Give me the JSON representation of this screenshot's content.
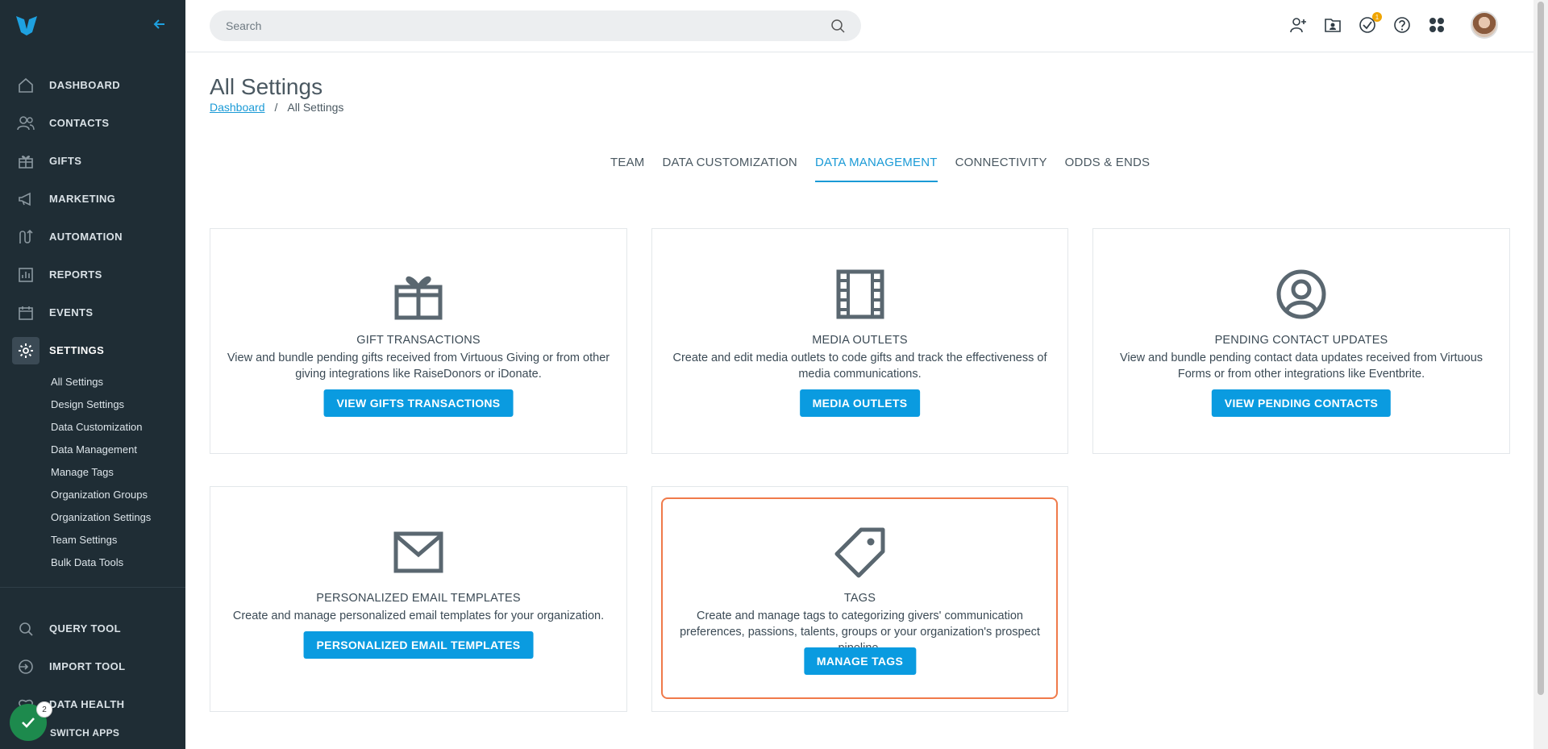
{
  "sidebar": {
    "nav": [
      {
        "label": "DASHBOARD",
        "icon": "home-icon"
      },
      {
        "label": "CONTACTS",
        "icon": "people-icon"
      },
      {
        "label": "GIFTS",
        "icon": "gift-icon"
      },
      {
        "label": "MARKETING",
        "icon": "megaphone-icon"
      },
      {
        "label": "AUTOMATION",
        "icon": "automation-icon"
      },
      {
        "label": "REPORTS",
        "icon": "reports-icon"
      },
      {
        "label": "EVENTS",
        "icon": "calendar-icon"
      },
      {
        "label": "SETTINGS",
        "icon": "gear-icon"
      }
    ],
    "subnav": [
      "All Settings",
      "Design Settings",
      "Data Customization",
      "Data Management",
      "Manage Tags",
      "Organization Groups",
      "Organization Settings",
      "Team Settings",
      "Bulk Data Tools"
    ],
    "bottom": [
      {
        "label": "QUERY TOOL",
        "icon": "query-icon"
      },
      {
        "label": "IMPORT TOOL",
        "icon": "import-icon"
      },
      {
        "label": "DATA HEALTH",
        "icon": "health-icon"
      }
    ],
    "task_count": "2",
    "switch_apps": "SWITCH APPS"
  },
  "topbar": {
    "search_placeholder": "Search",
    "notification_count": "1"
  },
  "page": {
    "title": "All Settings",
    "breadcrumb_link": "Dashboard",
    "breadcrumb_sep": "/",
    "breadcrumb_current": "All Settings"
  },
  "tabs": [
    "TEAM",
    "DATA CUSTOMIZATION",
    "DATA MANAGEMENT",
    "CONNECTIVITY",
    "ODDS & ENDS"
  ],
  "active_tab": "DATA MANAGEMENT",
  "cards": [
    {
      "title": "GIFT TRANSACTIONS",
      "desc": "View and bundle pending gifts received from Virtuous Giving or from other giving integrations like RaiseDonors or iDonate.",
      "button": "VIEW GIFTS TRANSACTIONS",
      "icon": "gift-icon"
    },
    {
      "title": "MEDIA OUTLETS",
      "desc": "Create and edit media outlets to code gifts and track the effectiveness of media communications.",
      "button": "MEDIA OUTLETS",
      "icon": "film-icon"
    },
    {
      "title": "PENDING CONTACT UPDATES",
      "desc": "View and bundle pending contact data updates received from Virtuous Forms or from other integrations like Eventbrite.",
      "button": "VIEW PENDING CONTACTS",
      "icon": "user-circle-icon"
    },
    {
      "title": "PERSONALIZED EMAIL TEMPLATES",
      "desc": "Create and manage personalized email templates for your organization.",
      "button": "PERSONALIZED EMAIL TEMPLATES",
      "icon": "envelope-icon"
    },
    {
      "title": "TAGS",
      "desc": "Create and manage tags to categorizing givers' communication preferences, passions, talents, groups or your organization's prospect pipeline.",
      "button": "MANAGE TAGS",
      "icon": "tag-icon"
    }
  ],
  "colors": {
    "sidebar": "#1f2d35",
    "accent": "#0a9be0",
    "highlight": "#f07a4a"
  }
}
